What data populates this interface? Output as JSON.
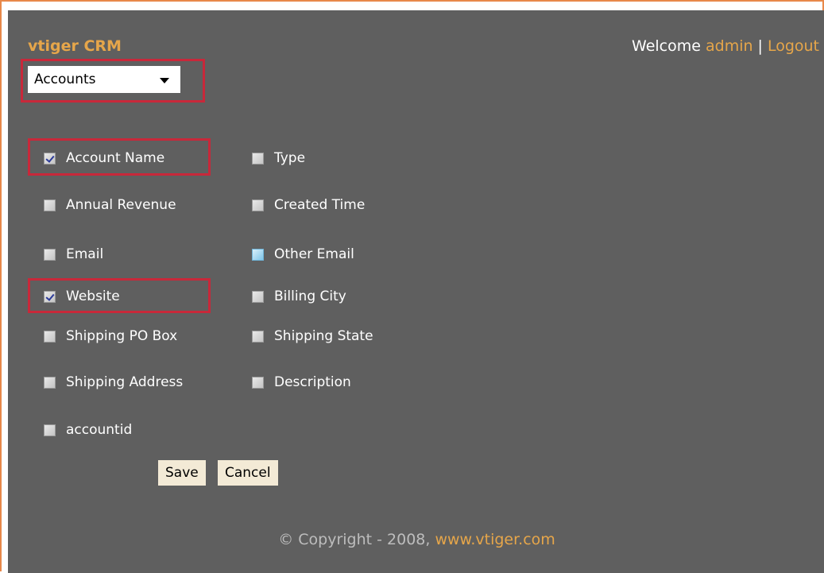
{
  "header": {
    "brand": "vtiger CRM",
    "welcome_prefix": "Welcome",
    "username": "admin",
    "separator": "|",
    "logout": "Logout"
  },
  "module_select": {
    "value": "Accounts"
  },
  "fields": [
    {
      "label": "Account Name",
      "checked": true
    },
    {
      "label": "Type",
      "checked": false
    },
    {
      "label": "Annual Revenue",
      "checked": false
    },
    {
      "label": "Created Time",
      "checked": false
    },
    {
      "label": "Email",
      "checked": false
    },
    {
      "label": "Other Email",
      "checked": false
    },
    {
      "label": "Website",
      "checked": true
    },
    {
      "label": "Billing City",
      "checked": false
    },
    {
      "label": "Shipping PO Box",
      "checked": false
    },
    {
      "label": "Shipping State",
      "checked": false
    },
    {
      "label": "Shipping Address",
      "checked": false
    },
    {
      "label": "Description",
      "checked": false
    },
    {
      "label": "accountid",
      "checked": false
    }
  ],
  "buttons": {
    "save": "Save",
    "cancel": "Cancel"
  },
  "footer": {
    "copyright": "© Copyright - 2008,",
    "site": "www.vtiger.com"
  },
  "colors": {
    "panel_bg": "#5f5f5f",
    "accent": "#e6a64a",
    "highlight_border": "#c8283a",
    "frame_border": "#e8884a"
  }
}
